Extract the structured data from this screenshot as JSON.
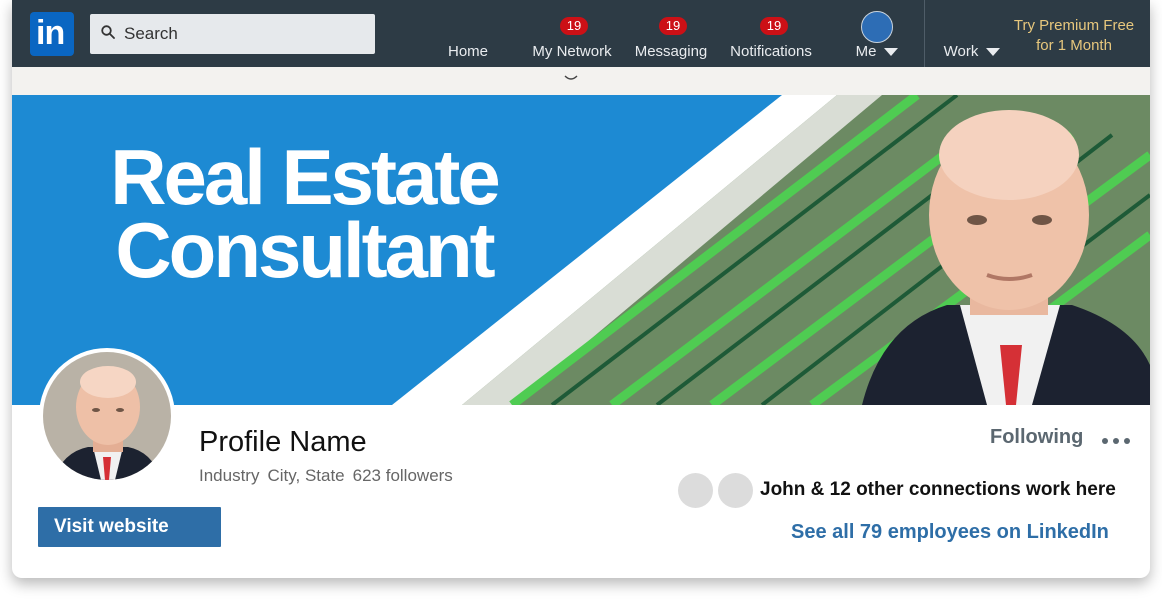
{
  "navbar": {
    "logo_text": "in",
    "search": {
      "placeholder": "Search"
    },
    "items": [
      {
        "label": "Home"
      },
      {
        "label": "My Network",
        "badge": "19"
      },
      {
        "label": "Messaging",
        "badge": "19"
      },
      {
        "label": "Notifications",
        "badge": "19"
      },
      {
        "label": "Me"
      }
    ],
    "work_label": "Work",
    "premium_line1": "Try Premium Free",
    "premium_line2": "for 1 Month"
  },
  "banner": {
    "headline_line1": "Real Estate",
    "headline_line2": "Consultant"
  },
  "profile": {
    "name": "Profile Name",
    "industry": "Industry",
    "location": "City, State",
    "followers": "623 followers",
    "visit_label": "Visit website"
  },
  "actions": {
    "following_label": "Following"
  },
  "connections": {
    "text": "John & 12 other connections work here",
    "see_all": "See all 79 employees on LinkedIn"
  },
  "colors": {
    "navbar": "#2d3b45",
    "brand": "#0a66c2",
    "badge": "#cc1016",
    "premium": "#e7c77d",
    "banner_blue": "#1d8ad3",
    "link": "#2e6ea7"
  }
}
